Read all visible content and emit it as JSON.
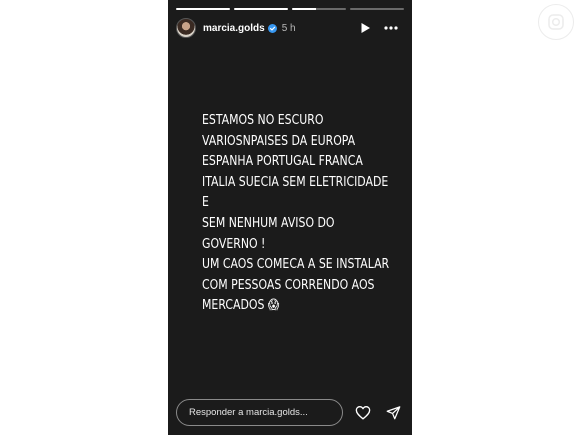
{
  "story": {
    "progress": [
      1,
      1,
      0.45,
      0
    ],
    "user": {
      "username": "marcia.golds",
      "time": "5 h",
      "verified": true
    },
    "icons": {
      "play": "play-icon",
      "more": "more-options-icon",
      "like": "heart-icon",
      "send": "send-icon",
      "verified": "verified-badge-icon"
    },
    "text_lines": [
      "ESTAMOS NO ESCURO",
      "VARIOSNPAISES DA EUROPA",
      "ESPANHA PORTUGAL FRANCA",
      "ITALIA SUECIA SEM ELETRICIDADE",
      "E",
      "SEM NENHUM AVISO DO",
      "GOVERNO !",
      "UM CAOS COMECA A SE INSTALAR",
      "COM PESSOAS CORRENDO AOS",
      "MERCADOS 😱"
    ],
    "reply_placeholder": "Responder a marcia.golds..."
  },
  "colors": {
    "story_background": "#1b1b1b",
    "verified_badge": "#3797f0"
  }
}
